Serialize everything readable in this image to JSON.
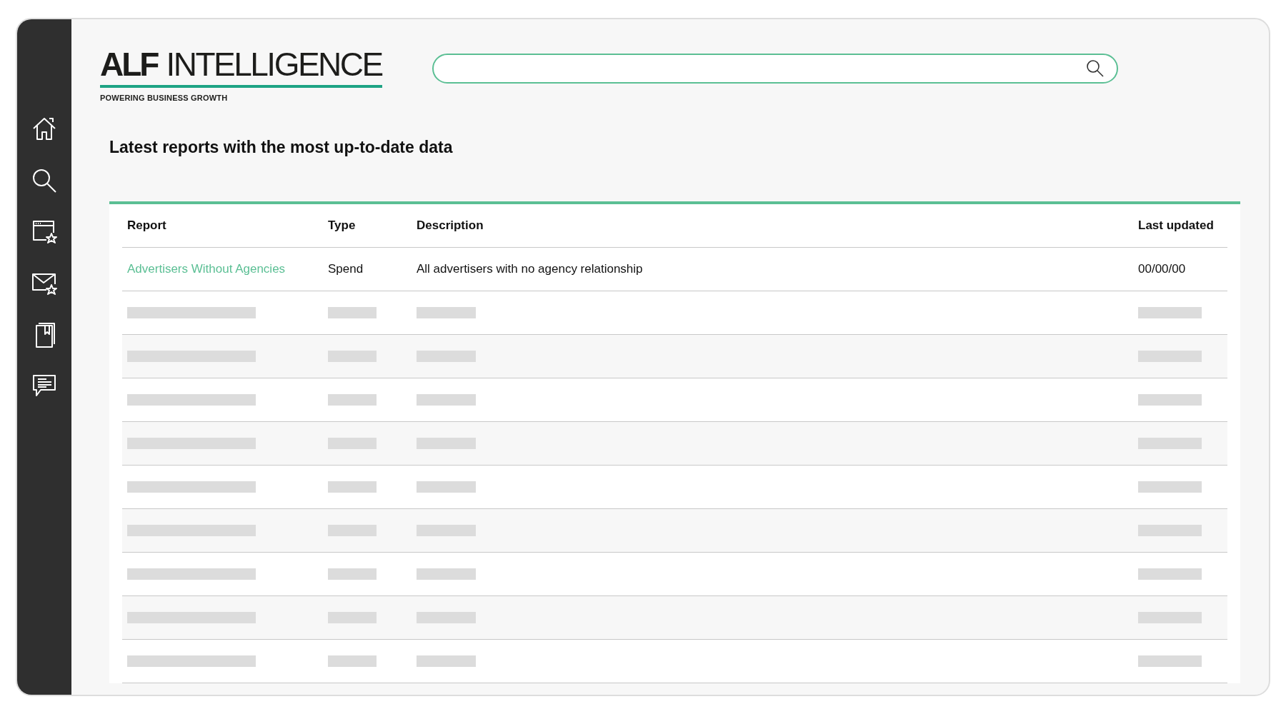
{
  "logo": {
    "brand": "ALF",
    "name": "INTELLIGENCE",
    "tagline": "POWERING BUSINESS GROWTH"
  },
  "heading": "Latest reports with the most up-to-date data",
  "table": {
    "columns": [
      "Report",
      "Type",
      "Description",
      "Last updated"
    ],
    "rows": [
      {
        "kind": "data",
        "report": "Advertisers Without Agencies",
        "type": "Spend",
        "description": "All advertisers with no agency relationship",
        "last_updated": "00/00/00"
      },
      {
        "kind": "placeholder"
      },
      {
        "kind": "placeholder"
      },
      {
        "kind": "placeholder"
      },
      {
        "kind": "placeholder"
      },
      {
        "kind": "placeholder"
      },
      {
        "kind": "placeholder"
      },
      {
        "kind": "placeholder"
      },
      {
        "kind": "placeholder"
      },
      {
        "kind": "placeholder"
      }
    ]
  }
}
